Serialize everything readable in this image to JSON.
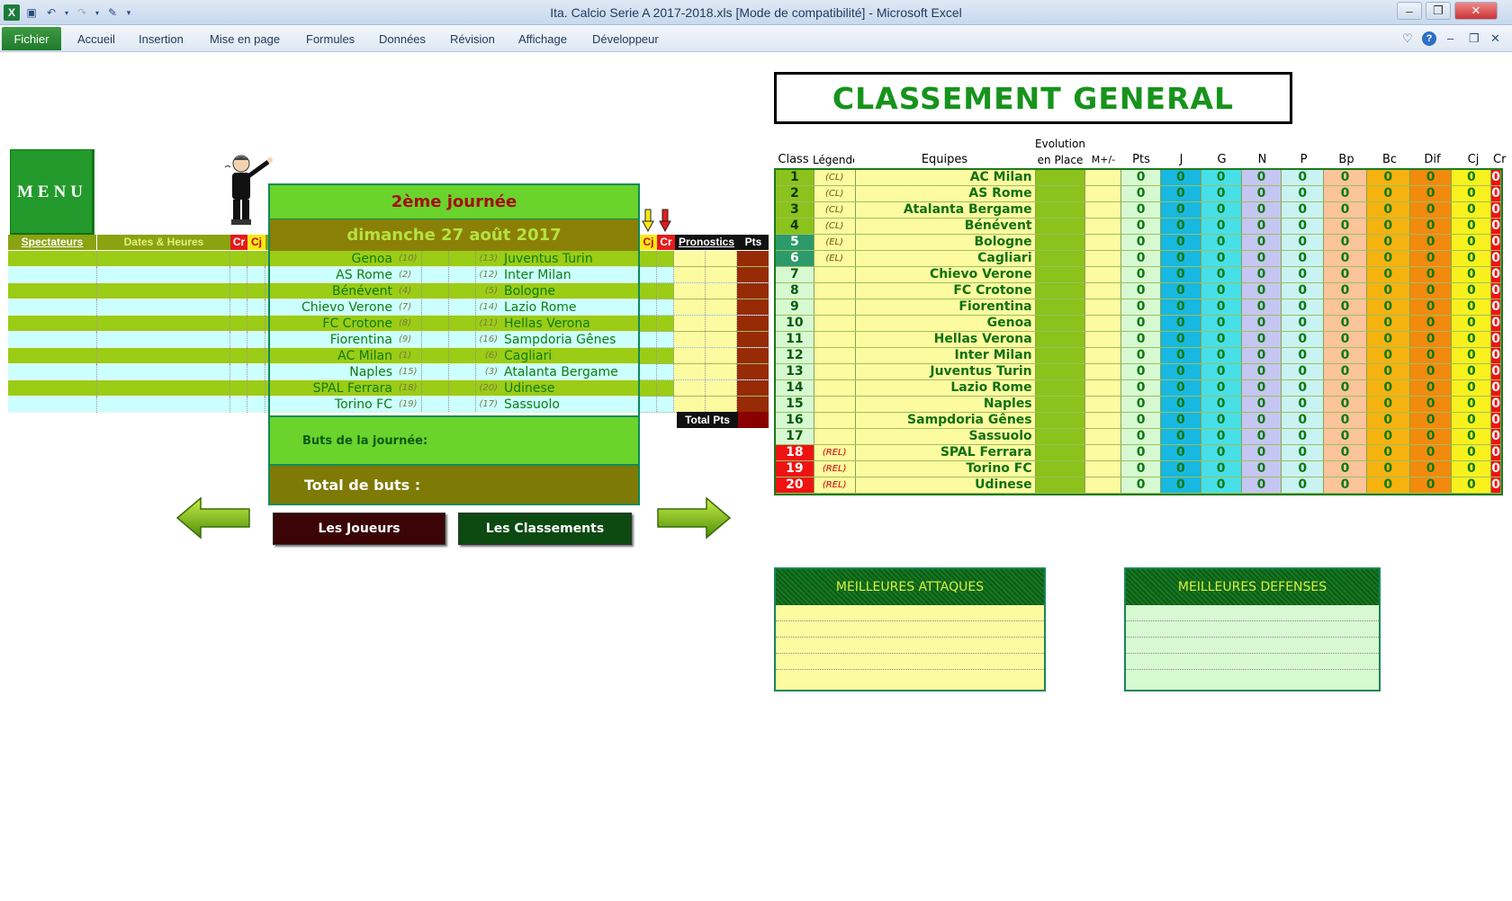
{
  "window": {
    "title": "Ita. Calcio Serie A 2017-2018.xls  [Mode de compatibilité]  -  Microsoft Excel"
  },
  "ribbon": {
    "file_tab": "Fichier",
    "tabs": [
      "Accueil",
      "Insertion",
      "Mise en page",
      "Formules",
      "Données",
      "Révision",
      "Affichage",
      "Développeur"
    ]
  },
  "sheet": {
    "menu_label": "MENU",
    "left_headers": {
      "spectators": "Spectateurs",
      "dates": "Dates & Heures",
      "cr": "Cr",
      "cj": "Cj"
    },
    "journee": {
      "title": "2ème journée",
      "date": "dimanche 27 août 2017",
      "matches": [
        {
          "home": "Genoa",
          "home_rank": "(10)",
          "away_rank": "(13)",
          "away": "Juventus Turin"
        },
        {
          "home": "AS Rome",
          "home_rank": "(2)",
          "away_rank": "(12)",
          "away": "Inter Milan"
        },
        {
          "home": "Bénévent",
          "home_rank": "(4)",
          "away_rank": "(5)",
          "away": "Bologne"
        },
        {
          "home": "Chievo Verone",
          "home_rank": "(7)",
          "away_rank": "(14)",
          "away": "Lazio Rome"
        },
        {
          "home": "FC Crotone",
          "home_rank": "(8)",
          "away_rank": "(11)",
          "away": "Hellas Verona"
        },
        {
          "home": "Fiorentina",
          "home_rank": "(9)",
          "away_rank": "(16)",
          "away": "Sampdoria Gênes"
        },
        {
          "home": "AC Milan",
          "home_rank": "(1)",
          "away_rank": "(6)",
          "away": "Cagliari"
        },
        {
          "home": "Naples",
          "home_rank": "(15)",
          "away_rank": "(3)",
          "away": "Atalanta Bergame"
        },
        {
          "home": "SPAL Ferrara",
          "home_rank": "(18)",
          "away_rank": "(20)",
          "away": "Udinese"
        },
        {
          "home": "Torino FC",
          "home_rank": "(19)",
          "away_rank": "(17)",
          "away": "Sassuolo"
        }
      ],
      "buts_label": "Buts de la journée:",
      "total_label": "Total de buts :"
    },
    "right_headers": {
      "cj": "Cj",
      "cr": "Cr",
      "pronostics": "Pronostics",
      "pts": "Pts"
    },
    "total_pts_label": "Total Pts",
    "buttons": {
      "joueurs": "Les Joueurs",
      "classements": "Les Classements"
    },
    "classement": {
      "title": "CLASSEMENT GENERAL",
      "headers": {
        "class": "Class",
        "legende": "Légende",
        "equipes": "Equipes",
        "evolution": "Evolution",
        "en_place": "en Place",
        "mplus": "M+/-",
        "pts": "Pts",
        "j": "J",
        "g": "G",
        "n": "N",
        "p": "P",
        "bp": "Bp",
        "bc": "Bc",
        "dif": "Dif",
        "cj": "Cj",
        "cr": "Cr"
      },
      "rows": [
        {
          "rank": "1",
          "legend": "(CL)",
          "team": "AC Milan",
          "zone": "cl"
        },
        {
          "rank": "2",
          "legend": "(CL)",
          "team": "AS Rome",
          "zone": "cl"
        },
        {
          "rank": "3",
          "legend": "(CL)",
          "team": "Atalanta Bergame",
          "zone": "cl"
        },
        {
          "rank": "4",
          "legend": "(CL)",
          "team": "Bénévent",
          "zone": "cl"
        },
        {
          "rank": "5",
          "legend": "(EL)",
          "team": "Bologne",
          "zone": "el"
        },
        {
          "rank": "6",
          "legend": "(EL)",
          "team": "Cagliari",
          "zone": "el"
        },
        {
          "rank": "7",
          "legend": "",
          "team": "Chievo Verone",
          "zone": "mid"
        },
        {
          "rank": "8",
          "legend": "",
          "team": "FC Crotone",
          "zone": "mid"
        },
        {
          "rank": "9",
          "legend": "",
          "team": "Fiorentina",
          "zone": "mid"
        },
        {
          "rank": "10",
          "legend": "",
          "team": "Genoa",
          "zone": "mid"
        },
        {
          "rank": "11",
          "legend": "",
          "team": "Hellas Verona",
          "zone": "mid"
        },
        {
          "rank": "12",
          "legend": "",
          "team": "Inter Milan",
          "zone": "mid"
        },
        {
          "rank": "13",
          "legend": "",
          "team": "Juventus Turin",
          "zone": "mid"
        },
        {
          "rank": "14",
          "legend": "",
          "team": "Lazio Rome",
          "zone": "mid"
        },
        {
          "rank": "15",
          "legend": "",
          "team": "Naples",
          "zone": "mid"
        },
        {
          "rank": "16",
          "legend": "",
          "team": "Sampdoria Gênes",
          "zone": "mid"
        },
        {
          "rank": "17",
          "legend": "",
          "team": "Sassuolo",
          "zone": "mid"
        },
        {
          "rank": "18",
          "legend": "(REL)",
          "team": "SPAL Ferrara",
          "zone": "rel"
        },
        {
          "rank": "19",
          "legend": "(REL)",
          "team": "Torino FC",
          "zone": "rel"
        },
        {
          "rank": "20",
          "legend": "(REL)",
          "team": "Udinese",
          "zone": "rel"
        }
      ],
      "stat_value": "0"
    },
    "best_attacks": "MEILLEURES ATTAQUES",
    "best_defenses": "MEILLEURES DEFENSES"
  },
  "colors": {
    "cl": "#8cc21c",
    "el": "#2c9a6a",
    "mid": "#d7f9d2",
    "rel": "#ef1212"
  }
}
